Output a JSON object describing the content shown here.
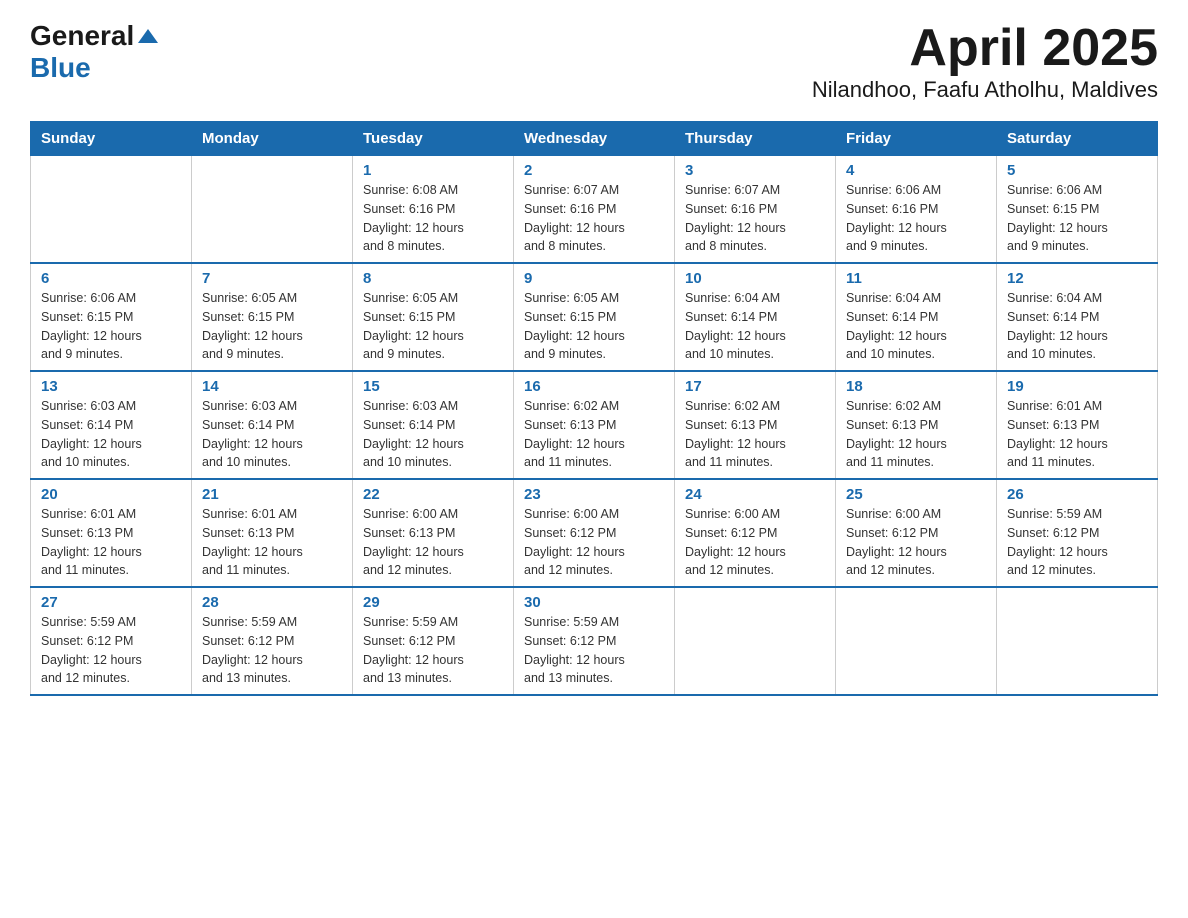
{
  "logo": {
    "general": "General",
    "blue": "Blue"
  },
  "title": "April 2025",
  "subtitle": "Nilandhoo, Faafu Atholhu, Maldives",
  "days_header": [
    "Sunday",
    "Monday",
    "Tuesday",
    "Wednesday",
    "Thursday",
    "Friday",
    "Saturday"
  ],
  "weeks": [
    [
      {
        "num": "",
        "info": ""
      },
      {
        "num": "",
        "info": ""
      },
      {
        "num": "1",
        "info": "Sunrise: 6:08 AM\nSunset: 6:16 PM\nDaylight: 12 hours\nand 8 minutes."
      },
      {
        "num": "2",
        "info": "Sunrise: 6:07 AM\nSunset: 6:16 PM\nDaylight: 12 hours\nand 8 minutes."
      },
      {
        "num": "3",
        "info": "Sunrise: 6:07 AM\nSunset: 6:16 PM\nDaylight: 12 hours\nand 8 minutes."
      },
      {
        "num": "4",
        "info": "Sunrise: 6:06 AM\nSunset: 6:16 PM\nDaylight: 12 hours\nand 9 minutes."
      },
      {
        "num": "5",
        "info": "Sunrise: 6:06 AM\nSunset: 6:15 PM\nDaylight: 12 hours\nand 9 minutes."
      }
    ],
    [
      {
        "num": "6",
        "info": "Sunrise: 6:06 AM\nSunset: 6:15 PM\nDaylight: 12 hours\nand 9 minutes."
      },
      {
        "num": "7",
        "info": "Sunrise: 6:05 AM\nSunset: 6:15 PM\nDaylight: 12 hours\nand 9 minutes."
      },
      {
        "num": "8",
        "info": "Sunrise: 6:05 AM\nSunset: 6:15 PM\nDaylight: 12 hours\nand 9 minutes."
      },
      {
        "num": "9",
        "info": "Sunrise: 6:05 AM\nSunset: 6:15 PM\nDaylight: 12 hours\nand 9 minutes."
      },
      {
        "num": "10",
        "info": "Sunrise: 6:04 AM\nSunset: 6:14 PM\nDaylight: 12 hours\nand 10 minutes."
      },
      {
        "num": "11",
        "info": "Sunrise: 6:04 AM\nSunset: 6:14 PM\nDaylight: 12 hours\nand 10 minutes."
      },
      {
        "num": "12",
        "info": "Sunrise: 6:04 AM\nSunset: 6:14 PM\nDaylight: 12 hours\nand 10 minutes."
      }
    ],
    [
      {
        "num": "13",
        "info": "Sunrise: 6:03 AM\nSunset: 6:14 PM\nDaylight: 12 hours\nand 10 minutes."
      },
      {
        "num": "14",
        "info": "Sunrise: 6:03 AM\nSunset: 6:14 PM\nDaylight: 12 hours\nand 10 minutes."
      },
      {
        "num": "15",
        "info": "Sunrise: 6:03 AM\nSunset: 6:14 PM\nDaylight: 12 hours\nand 10 minutes."
      },
      {
        "num": "16",
        "info": "Sunrise: 6:02 AM\nSunset: 6:13 PM\nDaylight: 12 hours\nand 11 minutes."
      },
      {
        "num": "17",
        "info": "Sunrise: 6:02 AM\nSunset: 6:13 PM\nDaylight: 12 hours\nand 11 minutes."
      },
      {
        "num": "18",
        "info": "Sunrise: 6:02 AM\nSunset: 6:13 PM\nDaylight: 12 hours\nand 11 minutes."
      },
      {
        "num": "19",
        "info": "Sunrise: 6:01 AM\nSunset: 6:13 PM\nDaylight: 12 hours\nand 11 minutes."
      }
    ],
    [
      {
        "num": "20",
        "info": "Sunrise: 6:01 AM\nSunset: 6:13 PM\nDaylight: 12 hours\nand 11 minutes."
      },
      {
        "num": "21",
        "info": "Sunrise: 6:01 AM\nSunset: 6:13 PM\nDaylight: 12 hours\nand 11 minutes."
      },
      {
        "num": "22",
        "info": "Sunrise: 6:00 AM\nSunset: 6:13 PM\nDaylight: 12 hours\nand 12 minutes."
      },
      {
        "num": "23",
        "info": "Sunrise: 6:00 AM\nSunset: 6:12 PM\nDaylight: 12 hours\nand 12 minutes."
      },
      {
        "num": "24",
        "info": "Sunrise: 6:00 AM\nSunset: 6:12 PM\nDaylight: 12 hours\nand 12 minutes."
      },
      {
        "num": "25",
        "info": "Sunrise: 6:00 AM\nSunset: 6:12 PM\nDaylight: 12 hours\nand 12 minutes."
      },
      {
        "num": "26",
        "info": "Sunrise: 5:59 AM\nSunset: 6:12 PM\nDaylight: 12 hours\nand 12 minutes."
      }
    ],
    [
      {
        "num": "27",
        "info": "Sunrise: 5:59 AM\nSunset: 6:12 PM\nDaylight: 12 hours\nand 12 minutes."
      },
      {
        "num": "28",
        "info": "Sunrise: 5:59 AM\nSunset: 6:12 PM\nDaylight: 12 hours\nand 13 minutes."
      },
      {
        "num": "29",
        "info": "Sunrise: 5:59 AM\nSunset: 6:12 PM\nDaylight: 12 hours\nand 13 minutes."
      },
      {
        "num": "30",
        "info": "Sunrise: 5:59 AM\nSunset: 6:12 PM\nDaylight: 12 hours\nand 13 minutes."
      },
      {
        "num": "",
        "info": ""
      },
      {
        "num": "",
        "info": ""
      },
      {
        "num": "",
        "info": ""
      }
    ]
  ]
}
